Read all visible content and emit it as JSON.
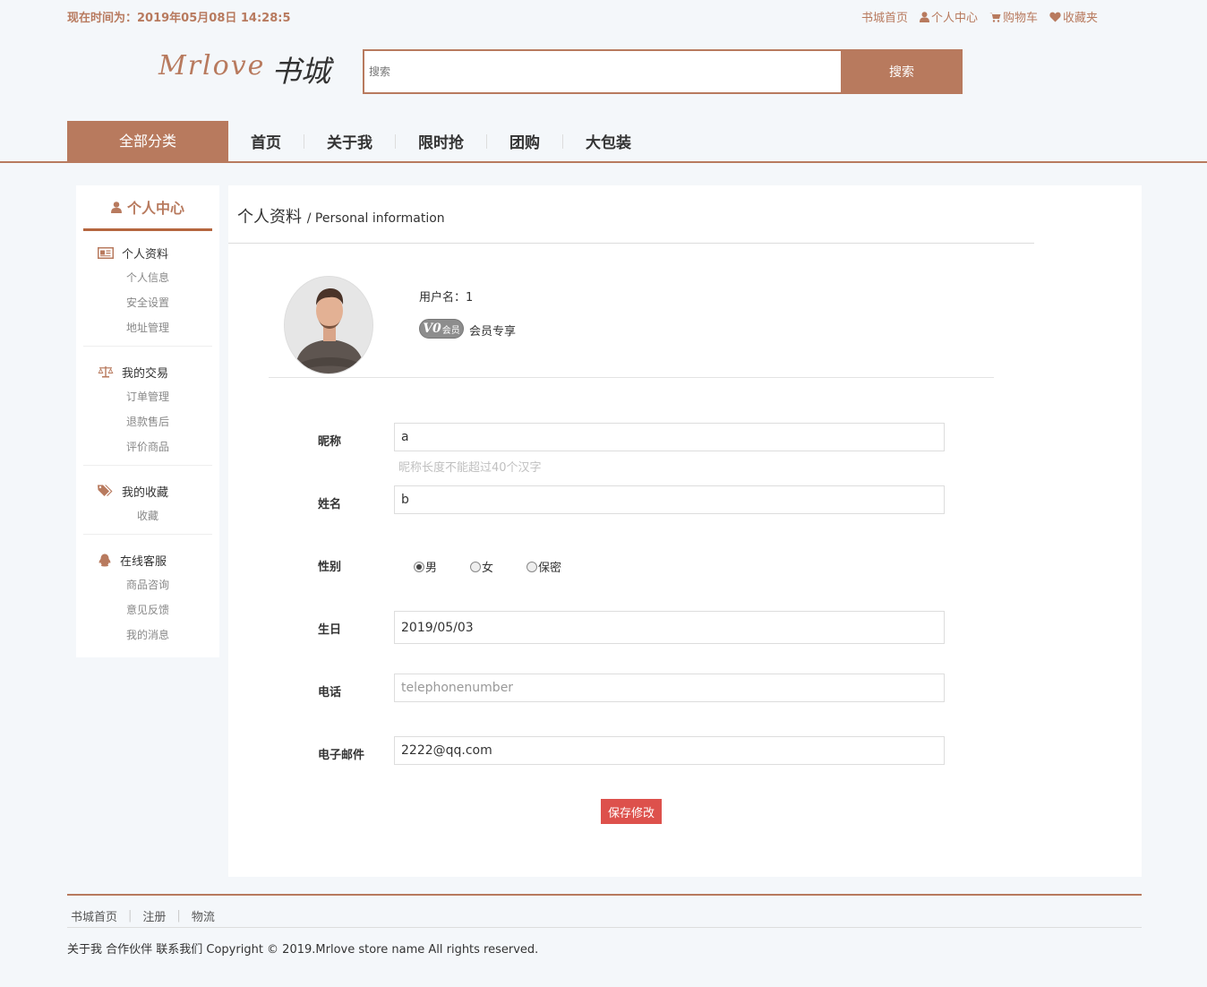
{
  "header": {
    "time_text": "现在时间为：2019年05月08日 14:28:5",
    "links": {
      "home": "书城首页",
      "personal_center": "个人中心",
      "cart": "购物车",
      "favorites": "收藏夹"
    },
    "logo_en": "Mrlove",
    "logo_cn": "书城",
    "search": {
      "placeholder": "搜索",
      "button": "搜索"
    }
  },
  "nav": {
    "all_categories": "全部分类",
    "items": [
      "首页",
      "关于我",
      "限时抢",
      "团购",
      "大包装"
    ]
  },
  "sidebar": {
    "title": "个人中心",
    "groups": [
      {
        "label": "个人资料",
        "icon": "id-card-icon",
        "items": [
          "个人信息",
          "安全设置",
          "地址管理"
        ]
      },
      {
        "label": "我的交易",
        "icon": "balance-scale-icon",
        "items": [
          "订单管理",
          "退款售后",
          "评价商品"
        ]
      },
      {
        "label": "我的收藏",
        "icon": "tags-icon",
        "items": [
          "收藏"
        ]
      },
      {
        "label": "在线客服",
        "icon": "qq-icon",
        "items": [
          "商品咨询",
          "意见反馈",
          "我的消息"
        ]
      }
    ]
  },
  "main": {
    "title": "个人资料",
    "subtitle": "/ Personal information",
    "username": "用户名：1",
    "vip_level": "V0",
    "vip_word": "会员",
    "member_text": "会员专享",
    "form": {
      "nickname_label": "昵称",
      "nickname_value": "a",
      "nickname_hint": "昵称长度不能超过40个汉字",
      "name_label": "姓名",
      "name_value": "b",
      "gender_label": "性别",
      "gender_options": [
        "男",
        "女",
        "保密"
      ],
      "gender_selected": "男",
      "birthday_label": "生日",
      "birthday_value": "2019/05/03",
      "phone_label": "电话",
      "phone_placeholder": "telephonenumber",
      "email_label": "电子邮件",
      "email_value": "2222@qq.com",
      "save_button": "保存修改"
    }
  },
  "footer": {
    "links": [
      "书城首页",
      "注册",
      "物流"
    ],
    "copyright": "关于我 合作伙伴 联系我们 Copyright © 2019.Mrlove store name All rights reserved."
  },
  "colors": {
    "accent": "#b87a5e",
    "save_button": "#dd514c",
    "background": "#f4f7fa"
  }
}
